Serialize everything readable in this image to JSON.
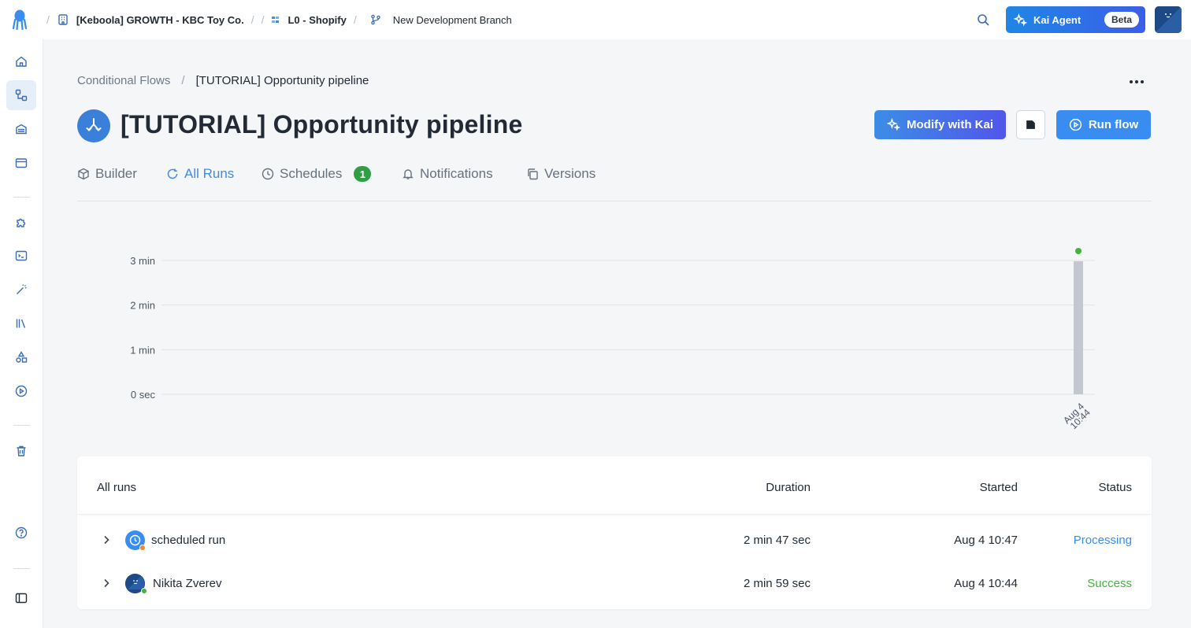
{
  "topbar": {
    "crumbs": [
      {
        "label": "[Keboola] GROWTH - KBC Toy Co."
      },
      {
        "label": ""
      },
      {
        "label": "L0 - Shopify"
      },
      {
        "label": "New Development Branch"
      }
    ],
    "kai_agent_label": "Kai Agent",
    "beta_label": "Beta"
  },
  "breadcrumb": {
    "parent": "Conditional Flows",
    "current": "[TUTORIAL] Opportunity pipeline"
  },
  "page": {
    "title": "[TUTORIAL] Opportunity pipeline"
  },
  "actions": {
    "modify_label": "Modify with Kai",
    "run_label": "Run flow"
  },
  "tabs": [
    {
      "label": "Builder",
      "icon": "box-icon"
    },
    {
      "label": "All Runs",
      "icon": "refresh-icon",
      "active": true
    },
    {
      "label": "Schedules",
      "icon": "clock-icon",
      "badge": "1"
    },
    {
      "label": "Notifications",
      "icon": "bell-icon"
    },
    {
      "label": "Versions",
      "icon": "copy-icon"
    }
  ],
  "chart_data": {
    "type": "bar",
    "categories": [
      "Aug 4 10:44"
    ],
    "tick_labels": [
      [
        "Aug 4",
        "10:44"
      ]
    ],
    "values": [
      179
    ],
    "y_unit": "seconds",
    "ylim": [
      0,
      180
    ],
    "y_ticks": [
      {
        "value": 0,
        "label": "0 sec"
      },
      {
        "value": 60,
        "label": "1 min"
      },
      {
        "value": 120,
        "label": "2 min"
      },
      {
        "value": 180,
        "label": "3 min"
      }
    ],
    "grid": true,
    "bar_color": "#c3c8d0",
    "status_dot_color": "#44b33d"
  },
  "runs": {
    "header": {
      "title": "All runs",
      "duration": "Duration",
      "started": "Started",
      "status": "Status"
    },
    "rows": [
      {
        "name": "scheduled run",
        "duration": "2 min 47 sec",
        "started": "Aug 4 10:47",
        "status": "Processing",
        "status_color": "#3a8df0",
        "dot_color": "#f08a24"
      },
      {
        "name": "Nikita Zverev",
        "duration": "2 min 59 sec",
        "started": "Aug 4 10:44",
        "status": "Success",
        "status_color": "#44b33d",
        "dot_color": "#44b33d"
      }
    ]
  },
  "colors": {
    "accent": "#3a8df0",
    "success": "#44b33d",
    "badge": "#2f9e44"
  }
}
